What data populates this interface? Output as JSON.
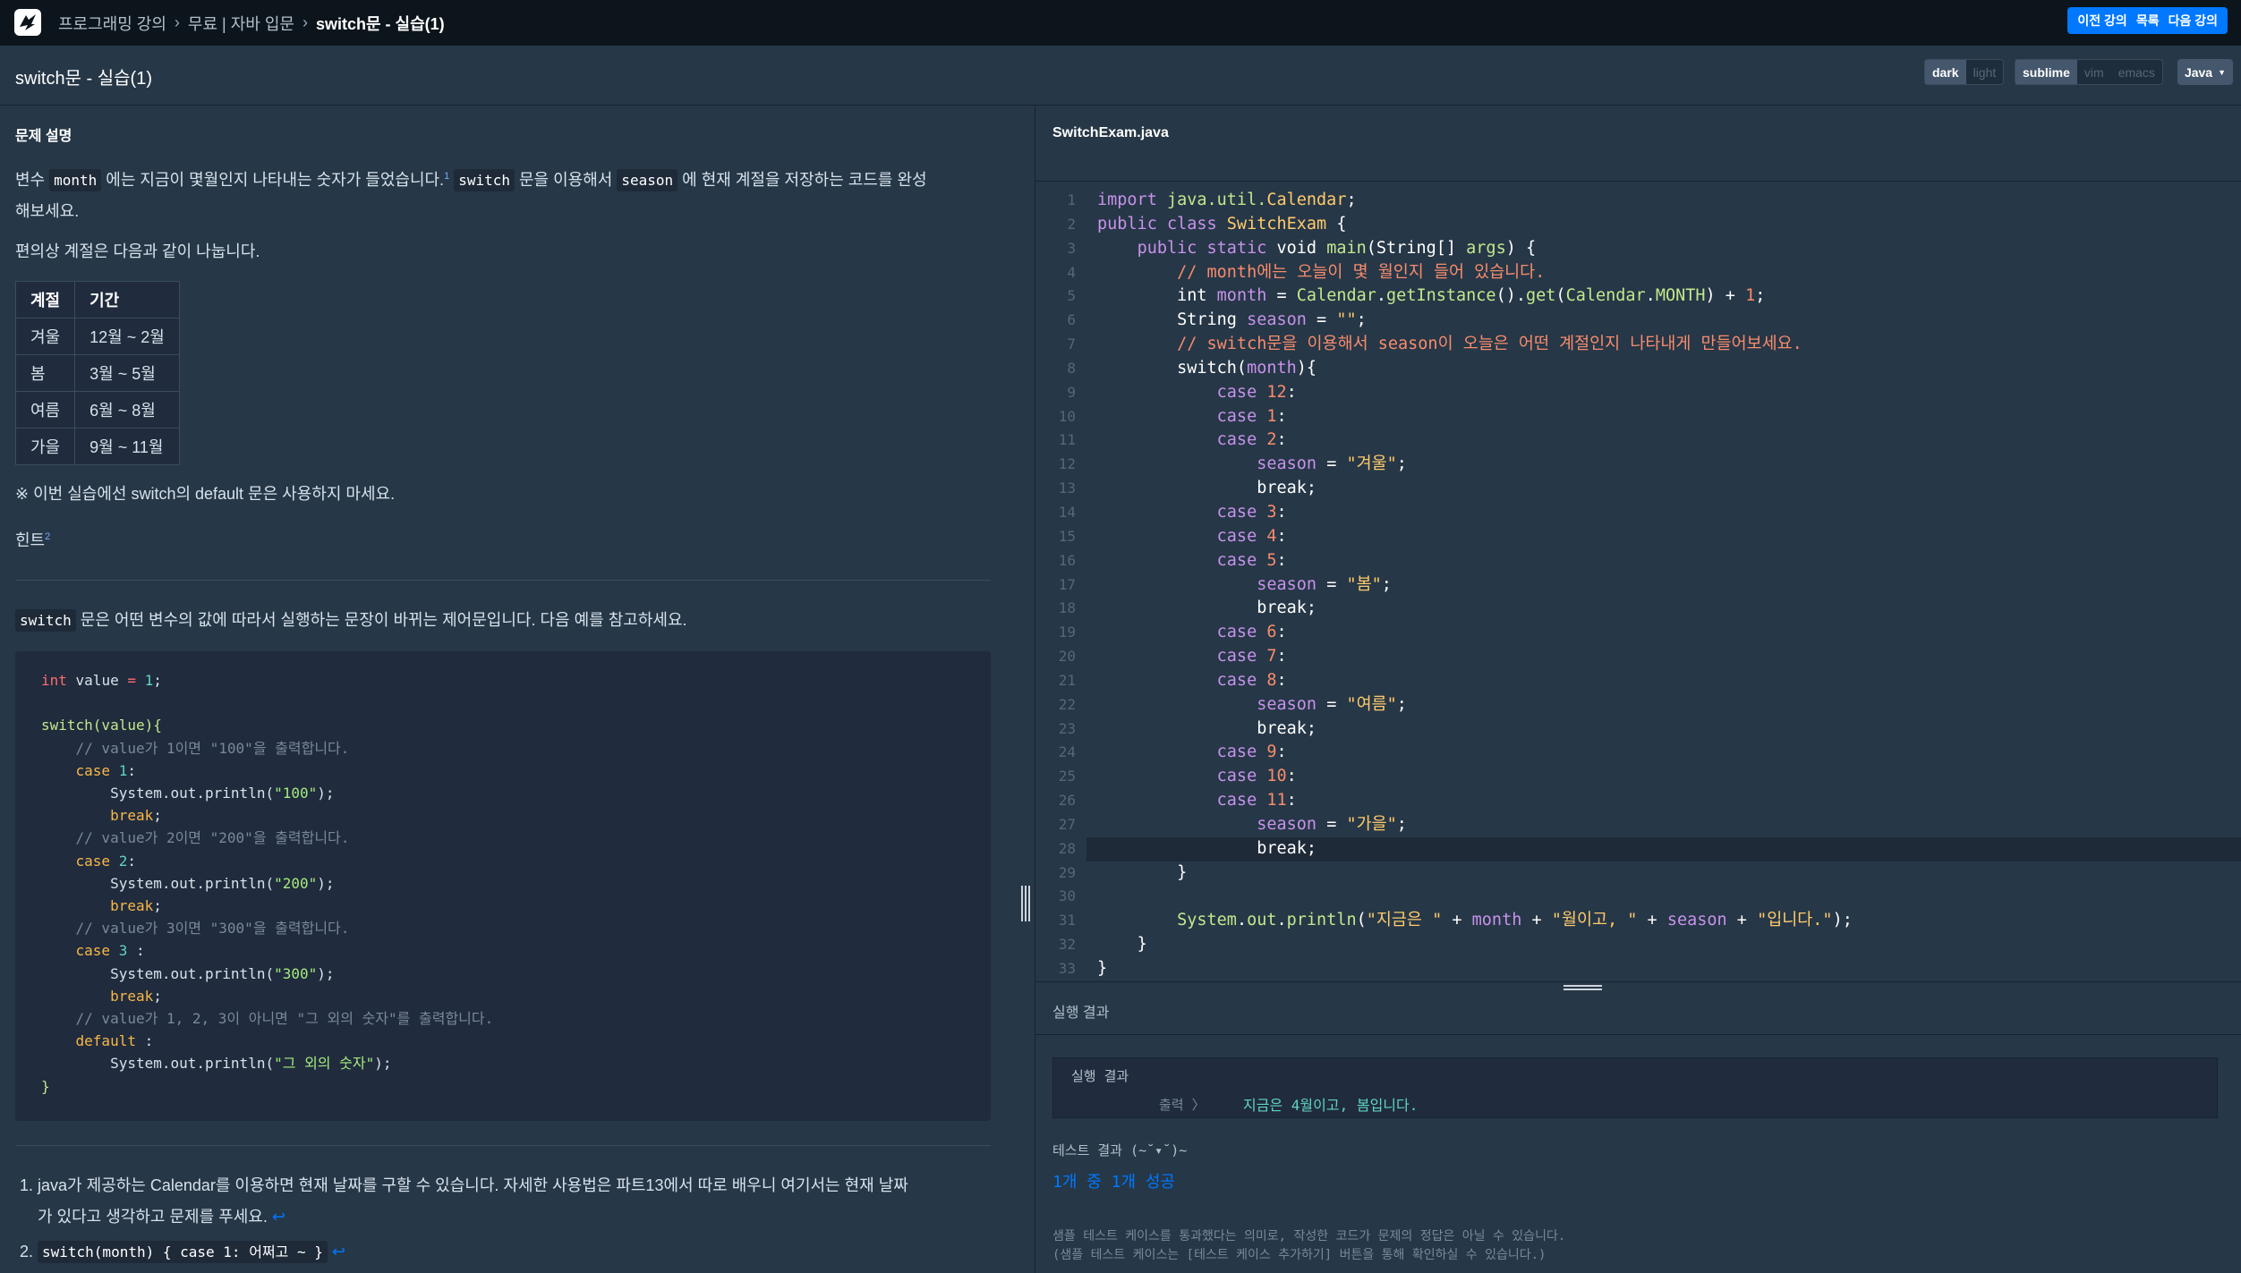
{
  "topbar": {
    "breadcrumbs": [
      "프로그래밍 강의",
      "무료 | 자바 입문",
      "switch문 - 실습(1)"
    ],
    "nav": {
      "prev": "이전 강의",
      "list": "목록",
      "next": "다음 강의"
    }
  },
  "titlebar": {
    "title": "switch문 - 실습(1)",
    "theme": {
      "dark": "dark",
      "light": "light",
      "selected": "dark"
    },
    "keymap": {
      "sublime": "sublime",
      "vim": "vim",
      "emacs": "emacs",
      "selected": "sublime"
    },
    "language": "Java"
  },
  "problem": {
    "heading": "문제 설명",
    "p1_a": "변수 ",
    "p1_code1": "month",
    "p1_b": " 에는 지금이 몇월인지 나타내는 숫자가 들었습니다.",
    "p1_sup": "1",
    "p1_code2": "switch",
    "p1_c": " 문을 이용해서 ",
    "p1_code3": "season",
    "p1_d": " 에 현재 계절을 저장하는 코드를 완성",
    "p1_line2": "해보세요.",
    "p2": "편의상 계절은 다음과 같이 나눕니다.",
    "table": {
      "headers": [
        "계절",
        "기간"
      ],
      "rows": [
        [
          "겨울",
          "12월 ~ 2월"
        ],
        [
          "봄",
          "3월 ~ 5월"
        ],
        [
          "여름",
          "6월 ~ 8월"
        ],
        [
          "가을",
          "9월 ~ 11월"
        ]
      ]
    },
    "note": "※ 이번 실습에선 switch의 default 문은 사용하지 마세요.",
    "hint": "힌트",
    "hint_sup": "2",
    "switch_code": "switch",
    "switch_desc": " 문은 어떤 변수의 값에 따라서 실행하는 문장이 바뀌는 제어문입니다. 다음 예를 참고하세요.",
    "footnotes": [
      "java가 제공하는 Calendar를 이용하면 현재 날짜를 구할 수 있습니다. 자세한 사용법은 파트13에서 따로 배우니 여기서는 현재 날짜",
      "가 있다고 생각하고 문제를 푸세요.",
      "switch(month) { case 1: 어쩌고 ~ }"
    ],
    "return_icon": "↩"
  },
  "editor": {
    "filename": "SwitchExam.java",
    "line_count": 33,
    "current_line": 28
  },
  "result": {
    "header": "실행 결과",
    "box_title": "실행 결과",
    "output_label": "출력 〉",
    "output_value": "지금은 4월이고, 봄입니다.",
    "test_title": "테스트 결과 (~˘▾˘)~",
    "summary": "1개 중 1개 성공",
    "note1": "샘플 테스트 케이스를 통과했다는 의미로, 작성한 코드가 문제의 정답은 아닐 수 있습니다.",
    "note2": "(샘플 테스트 케이스는 [테스트 케이스 추가하기] 버튼을 통해 확인하실 수 있습니다.)"
  }
}
